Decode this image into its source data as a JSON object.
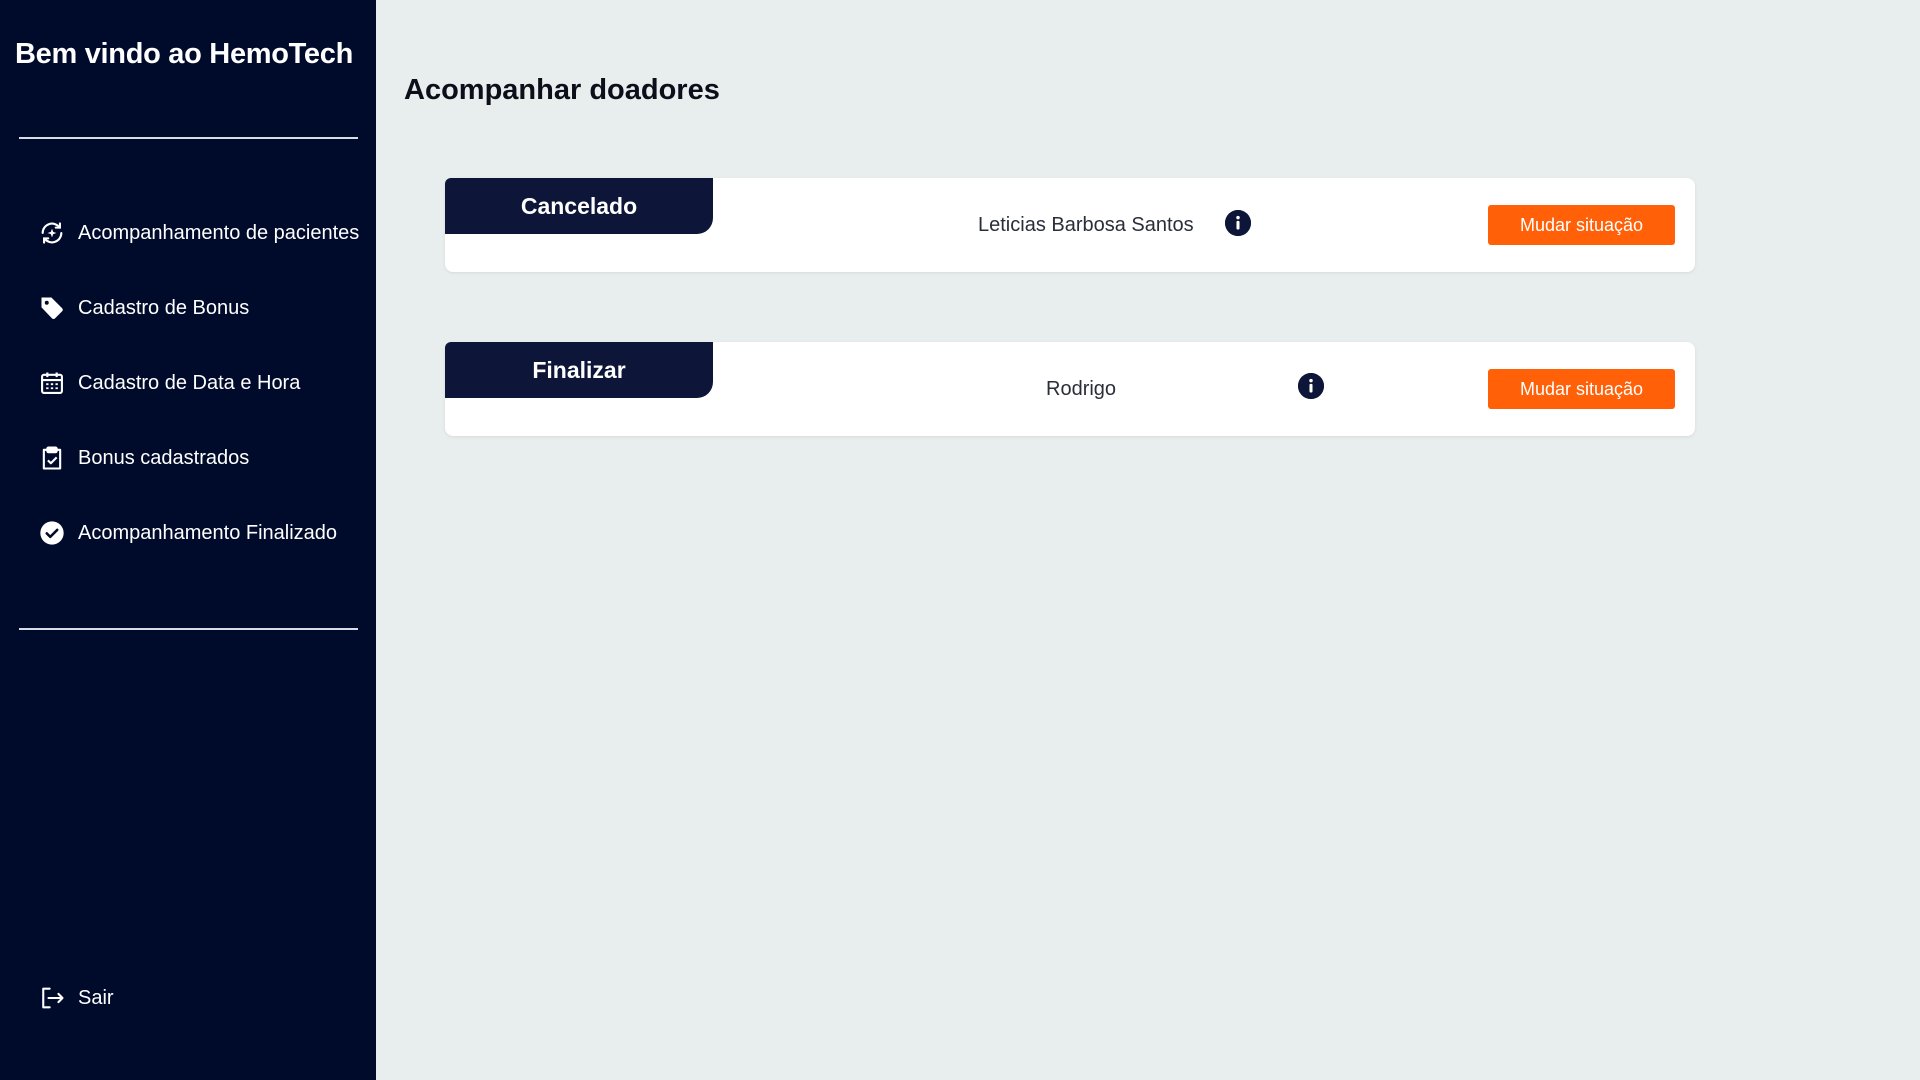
{
  "sidebar": {
    "title": "Bem vindo ao HemoTech",
    "items": [
      {
        "label": "Acompanhamento de pacientes",
        "icon": "sparkle-refresh-icon"
      },
      {
        "label": "Cadastro de Bonus",
        "icon": "tag-icon"
      },
      {
        "label": "Cadastro de Data e Hora",
        "icon": "calendar-icon"
      },
      {
        "label": "Bonus cadastrados",
        "icon": "clipboard-check-icon"
      },
      {
        "label": "Acompanhamento Finalizado",
        "icon": "check-circle-icon"
      }
    ],
    "logout": {
      "label": "Sair",
      "icon": "logout-icon"
    }
  },
  "main": {
    "title": "Acompanhar doadores",
    "cards": [
      {
        "status": "Cancelado",
        "donor": "Leticias Barbosa Santos",
        "action_label": "Mudar situação"
      },
      {
        "status": "Finalizar",
        "donor": "Rodrigo",
        "action_label": "Mudar situação"
      }
    ]
  },
  "colors": {
    "sidebar_bg": "#000a2b",
    "page_bg": "#e8eded",
    "status_tab_bg": "#0d1638",
    "accent_button": "#ff6008"
  }
}
